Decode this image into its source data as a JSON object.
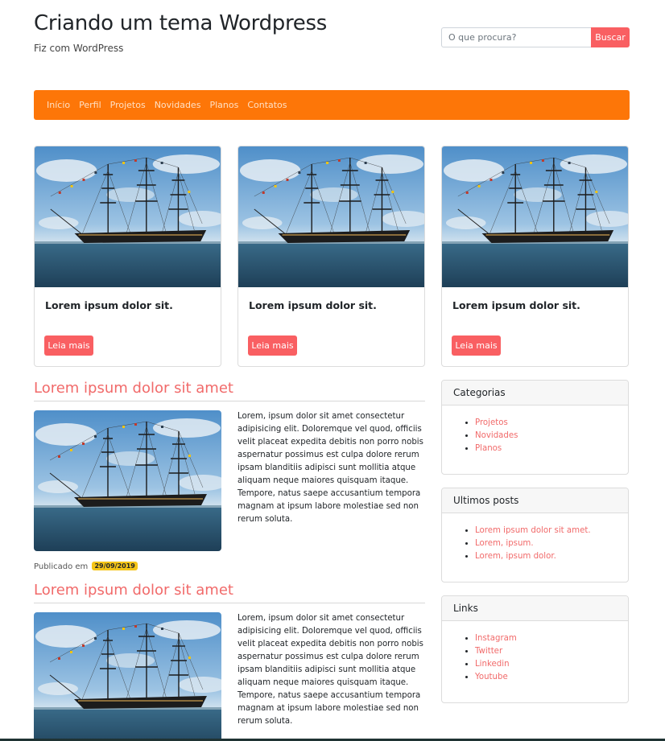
{
  "header": {
    "title": "Criando um tema Wordpress",
    "tagline": "Fiz com WordPress",
    "search": {
      "placeholder": "O que procura?",
      "button_label": "Buscar"
    }
  },
  "nav": {
    "items": [
      "Início",
      "Perfil",
      "Projetos",
      "Novidades",
      "Planos",
      "Contatos"
    ]
  },
  "cards": [
    {
      "title": "Lorem ipsum dolor sit.",
      "button_label": "Leia mais"
    },
    {
      "title": "Lorem ipsum dolor sit.",
      "button_label": "Leia mais"
    },
    {
      "title": "Lorem ipsum dolor sit.",
      "button_label": "Leia mais"
    }
  ],
  "posts": [
    {
      "title": "Lorem ipsum dolor sit amet",
      "body": "Lorem, ipsum dolor sit amet consectetur adipisicing elit. Doloremque vel quod, officiis velit placeat expedita debitis non porro nobis aspernatur possimus est culpa dolore rerum ipsam blanditiis adipisci sunt mollitia atque aliquam neque maiores quisquam itaque. Tempore, natus saepe accusantium tempora magnam at ipsum labore molestiae sed non rerum soluta.",
      "published_label": "Publicado em",
      "date": "29/09/2019"
    },
    {
      "title": "Lorem ipsum dolor sit amet",
      "body": "Lorem, ipsum dolor sit amet consectetur adipisicing elit. Doloremque vel quod, officiis velit placeat expedita debitis non porro nobis aspernatur possimus est culpa dolore rerum ipsam blanditiis adipisci sunt mollitia atque aliquam neque maiores quisquam itaque. Tempore, natus saepe accusantium tempora magnam at ipsum labore molestiae sed non rerum soluta."
    }
  ],
  "sidebar": {
    "categories": {
      "title": "Categorias",
      "items": [
        "Projetos",
        "Novidades",
        "Planos"
      ]
    },
    "recent": {
      "title": "Ultimos posts",
      "items": [
        "Lorem ipsum dolor sit amet.",
        "Lorem, ipsum.",
        "Lorem, ipsum dolor."
      ]
    },
    "links": {
      "title": "Links",
      "items": [
        "Instagram",
        "Twitter",
        "Linkedin",
        "Youtube"
      ]
    }
  },
  "colors": {
    "navbar": "#fd7608",
    "accent": "#f95f62",
    "link": "#f16a6a",
    "badge": "#f5c518"
  }
}
